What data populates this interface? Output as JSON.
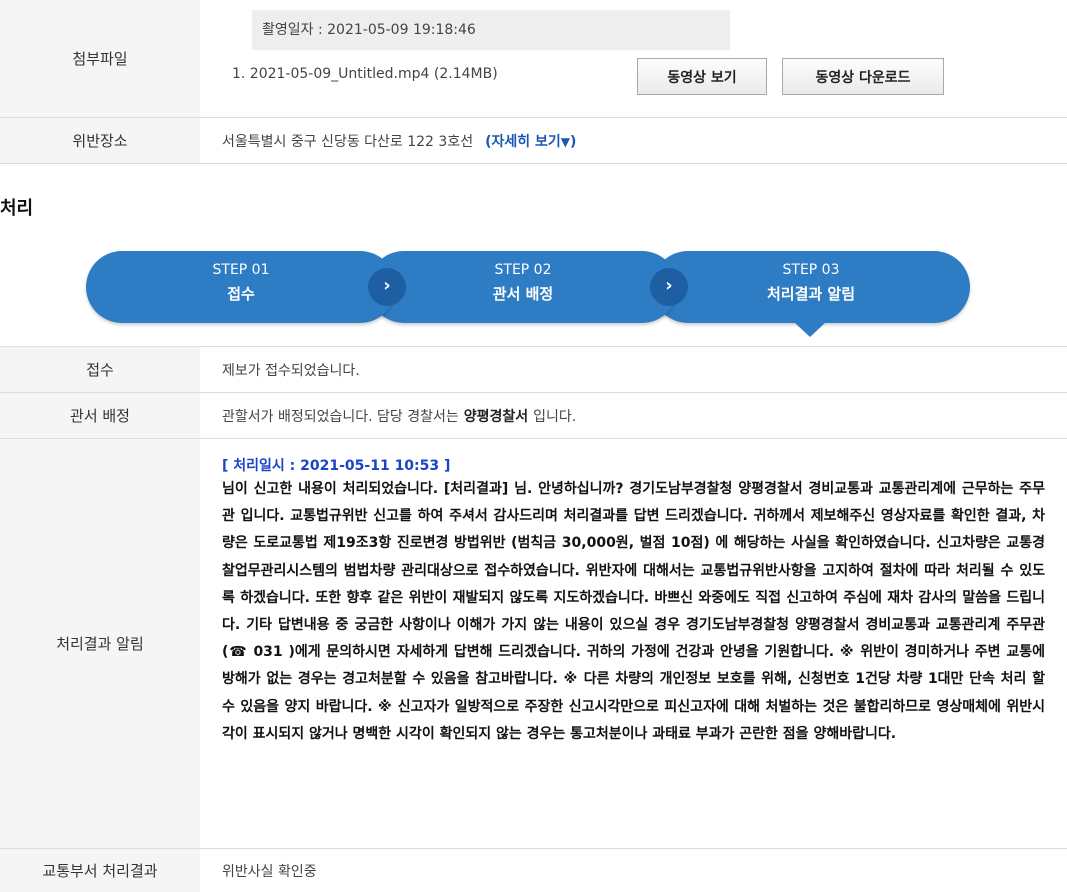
{
  "attachment": {
    "label": "첨부파일",
    "shoot_date": "촬영일자 : 2021-05-09 19:18:46",
    "file": "1. 2021-05-09_Untitled.mp4 (2.14MB)",
    "view_button": "동영상 보기",
    "download_button": "동영상 다운로드"
  },
  "location": {
    "label": "위반장소",
    "address": "서울특별시 중구 신당동 다산로 122 3호선",
    "detail_link": "(자세히 보기",
    "detail_arrow": "▼",
    "detail_close": ")"
  },
  "section_title": "처리",
  "steps": [
    {
      "no": "STEP 01",
      "name": "접수"
    },
    {
      "no": "STEP 02",
      "name": "관서 배정"
    },
    {
      "no": "STEP 03",
      "name": "처리결과 알림"
    }
  ],
  "receipt": {
    "label": "접수",
    "text": "제보가 접수되었습니다."
  },
  "assign": {
    "label": "관서 배정",
    "text_before": "관할서가 배정되었습니다. 담당 경찰서는",
    "station": "양평경찰서",
    "text_after": "입니다."
  },
  "result": {
    "label": "처리결과 알림",
    "process_time": "[ 처리일시 : 2021-05-11 10:53 ]",
    "text": "님이 신고한 내용이 처리되었습니다. [처리결과] 님. 안녕하십니까? 경기도남부경찰청 양평경찰서 경비교통과 교통관리계에 근무하는 주무관 입니다. 교통법규위반 신고를 하여 주셔서 감사드리며 처리결과를 답변 드리겠습니다. 귀하께서 제보해주신 영상자료를 확인한 결과, 차량은 도로교통법 제19조3항 진로변경 방법위반 (범칙금 30,000원, 벌점 10점) 에 해당하는 사실을 확인하였습니다. 신고차량은 교통경찰업무관리시스템의 범법차량 관리대상으로 접수하였습니다. 위반자에 대해서는 교통법규위반사항을 고지하여 절차에 따라 처리될 수 있도록 하겠습니다. 또한 향후 같은 위반이 재발되지 않도록 지도하겠습니다. 바쁘신 와중에도 직접 신고하여 주심에 재차 감사의 말씀을 드립니다. 기타 답변내용 중 궁금한 사항이나 이해가 가지 않는 내용이 있으실 경우 경기도남부경찰청 양평경찰서 경비교통과 교통관리계 주무관 (☎ 031 )에게 문의하시면 자세하게 답변해 드리겠습니다. 귀하의 가정에 건강과 안녕을 기원합니다. ※ 위반이 경미하거나 주변 교통에 방해가 없는 경우는 경고처분할 수 있음을 참고바랍니다. ※ 다른 차량의 개인정보 보호를 위해, 신청번호 1건당 차량 1대만 단속 처리 할 수 있음을 양지 바랍니다. ※ 신고자가 일방적으로 주장한 신고시각만으로 피신고자에 대해 처벌하는 것은 불합리하므로 영상매체에 위반시각이 표시되지 않거나 명백한 시각이 확인되지 않는 경우는 통고처분이나 과태료 부과가 곤란한 점을 양해바랍니다."
  },
  "traffic": {
    "label": "교통부서 처리결과",
    "text": "위반사실 확인중"
  }
}
